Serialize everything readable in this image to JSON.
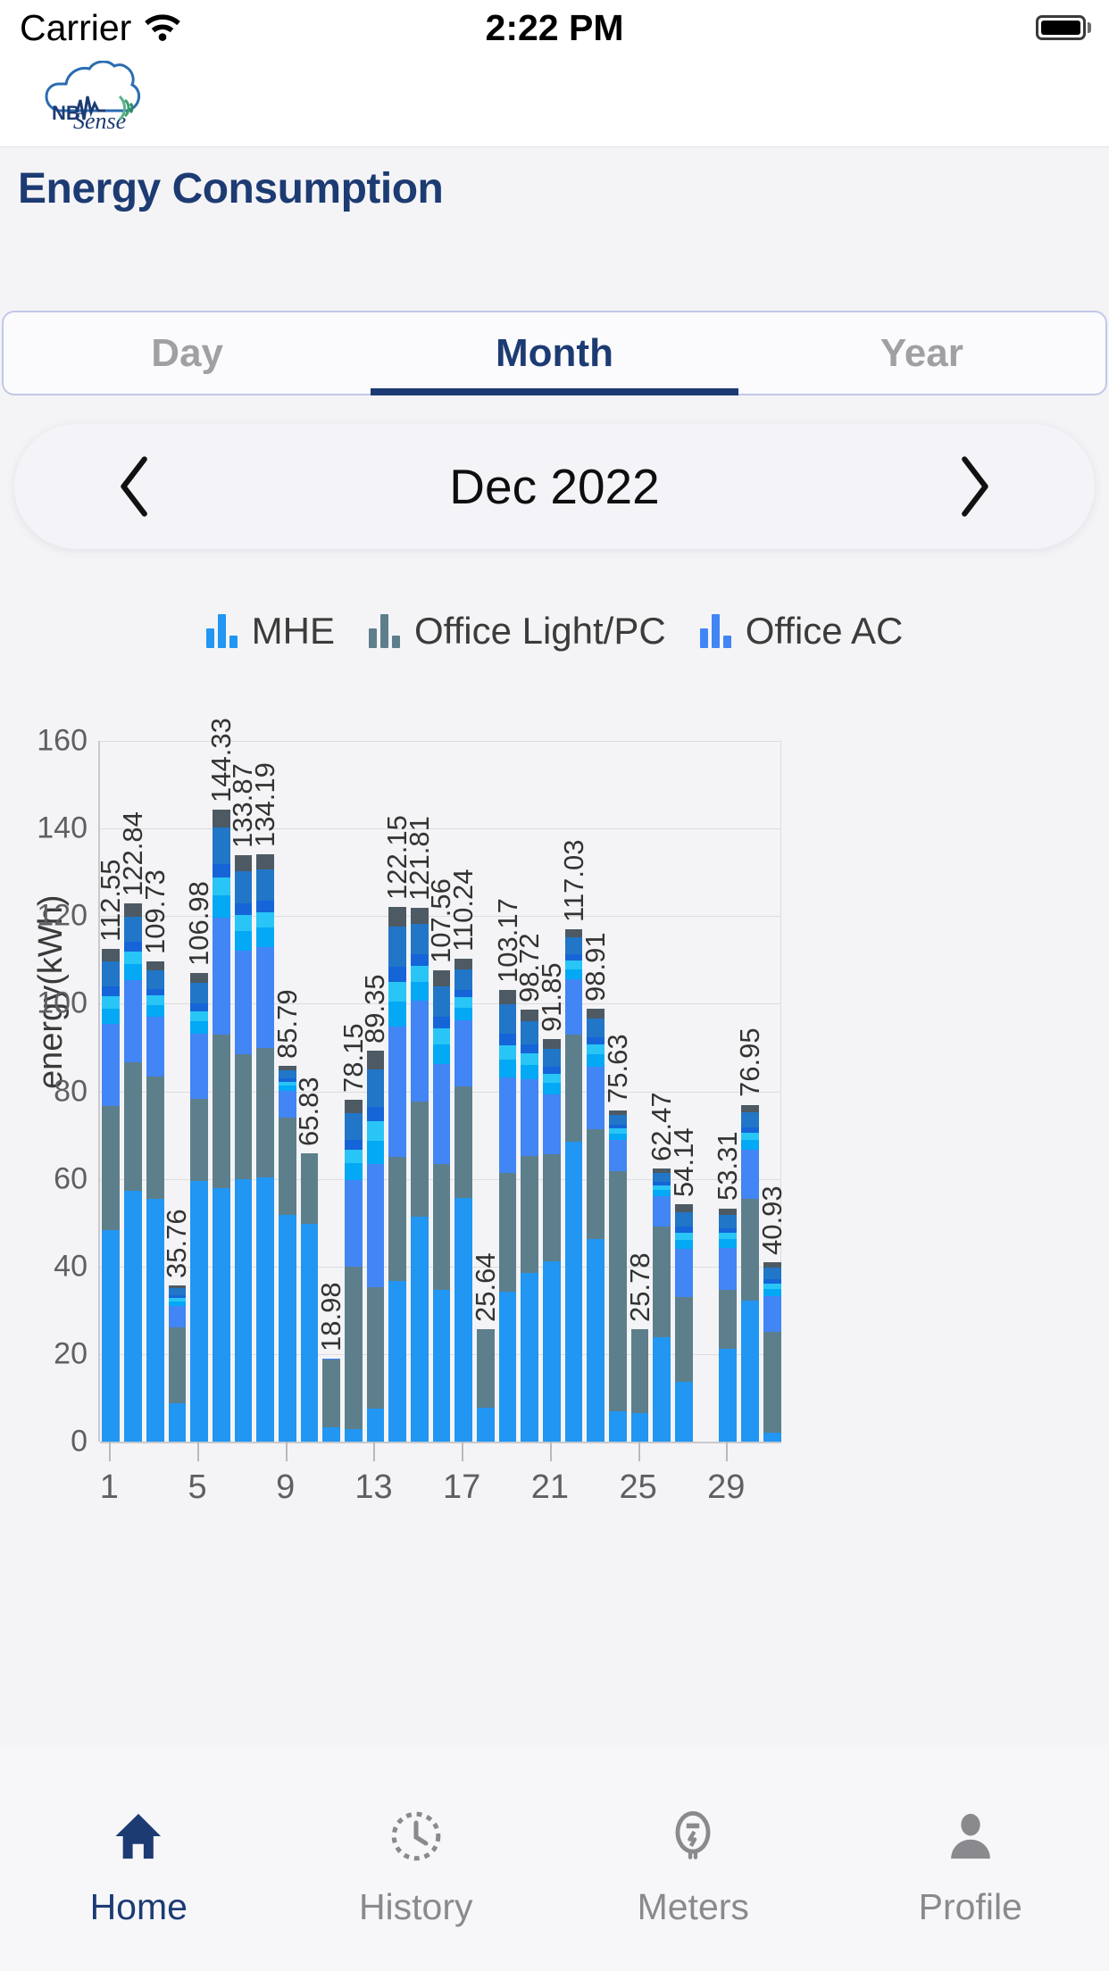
{
  "status_bar": {
    "carrier": "Carrier",
    "wifi_icon": "wifi-icon",
    "time": "2:22 PM",
    "battery_icon": "battery-full-icon"
  },
  "header": {
    "logo_text": "NBSense",
    "logo_icon": "nbsense-cloud-logo"
  },
  "page_title": "Energy Consumption",
  "tabs": [
    {
      "label": "Day",
      "active": false
    },
    {
      "label": "Month",
      "active": true
    },
    {
      "label": "Year",
      "active": false
    }
  ],
  "period_selector": {
    "prev_icon": "chevron-left-icon",
    "next_icon": "chevron-right-icon",
    "value": "Dec 2022"
  },
  "colors": {
    "accent": "#1d3b73",
    "mhe": "#2196f3",
    "office_light_pc": "#5d7f8c",
    "office_ac": "#4285f4",
    "seg_blue_light": "#03a9f4",
    "seg_blue_cyan": "#29c5f6",
    "seg_blue_royal": "#1565d8",
    "seg_blue_steel": "#2176c7",
    "seg_slate": "#4d5a63",
    "inactive_text": "#a0a0a3",
    "muted_text": "#8a8a8e"
  },
  "chart_data": {
    "type": "bar",
    "title": "",
    "xlabel": "",
    "ylabel": "energy(kWh)",
    "ylim": [
      0,
      160
    ],
    "yticks": [
      0,
      20,
      40,
      60,
      80,
      100,
      120,
      140,
      160
    ],
    "grid": true,
    "legend_position": "top",
    "stacked": true,
    "legend": [
      "MHE",
      "Office Light/PC",
      "Office AC"
    ],
    "categories": [
      1,
      2,
      3,
      4,
      5,
      6,
      7,
      8,
      9,
      10,
      11,
      12,
      13,
      14,
      15,
      16,
      17,
      18,
      19,
      20,
      21,
      22,
      23,
      24,
      25,
      26,
      27,
      28,
      29,
      30,
      31
    ],
    "xtick_labels": [
      "1",
      "5",
      "9",
      "13",
      "17",
      "21",
      "25",
      "29"
    ],
    "xtick_positions": [
      1,
      5,
      9,
      13,
      17,
      21,
      25,
      29
    ],
    "totals": [
      112.55,
      122.84,
      109.73,
      35.76,
      106.98,
      144.33,
      133.87,
      134.19,
      85.79,
      65.83,
      18.98,
      78.15,
      89.35,
      122.15,
      121.81,
      107.56,
      110.24,
      25.64,
      103.17,
      98.72,
      91.85,
      117.03,
      98.91,
      75.63,
      25.78,
      62.47,
      54.14,
      null,
      53.31,
      76.95,
      40.93
    ],
    "series": [
      {
        "name": "MHE",
        "color": "#2196f3",
        "values": [
          48.3,
          57.2,
          55.5,
          8.8,
          59.6,
          57.8,
          60.0,
          60.4,
          51.8,
          49.9,
          3.3,
          2.9,
          7.5,
          36.6,
          51.4,
          34.7,
          55.6,
          7.8,
          34.3,
          38.5,
          41.2,
          68.4,
          46.3,
          7.0,
          6.6,
          23.9,
          13.6,
          null,
          21.3,
          32.2,
          2.1
        ]
      },
      {
        "name": "Office Light/PC",
        "color": "#5d7f8c",
        "values": [
          28.4,
          29.4,
          27.9,
          17.2,
          18.6,
          35.1,
          28.4,
          29.5,
          22.1,
          16.1,
          15.5,
          37.0,
          27.7,
          28.4,
          26.3,
          28.6,
          25.5,
          17.8,
          27.0,
          26.8,
          24.4,
          24.6,
          25.0,
          54.8,
          19.2,
          25.2,
          19.4,
          null,
          13.3,
          23.3,
          23.0
        ]
      },
      {
        "name": "Office AC",
        "color": "#4285f4",
        "values": [
          35.85,
          36.24,
          26.33,
          9.76,
          28.78,
          51.43,
          45.47,
          44.29,
          11.89,
          -0.17,
          0.18,
          38.25,
          54.15,
          57.15,
          44.11,
          44.26,
          29.14,
          0.04,
          41.87,
          33.42,
          26.25,
          24.03,
          27.61,
          13.83,
          -0.02,
          13.37,
          21.14,
          null,
          18.71,
          21.45,
          15.83
        ]
      }
    ]
  },
  "bottom_nav": [
    {
      "label": "Home",
      "icon": "home-icon",
      "active": true
    },
    {
      "label": "History",
      "icon": "history-icon",
      "active": false
    },
    {
      "label": "Meters",
      "icon": "meter-icon",
      "active": false
    },
    {
      "label": "Profile",
      "icon": "person-icon",
      "active": false
    }
  ]
}
